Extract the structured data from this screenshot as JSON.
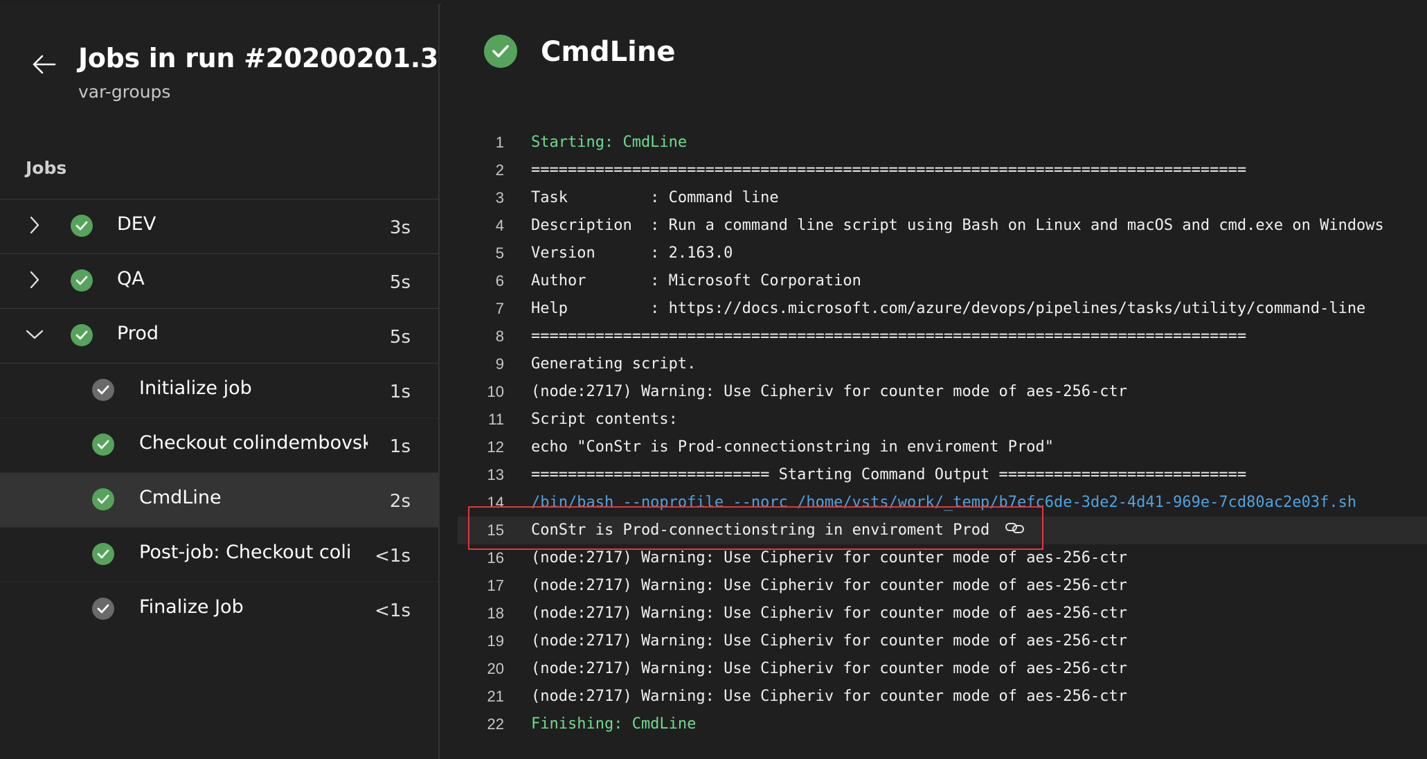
{
  "left_pane": {
    "title": "Jobs in run #20200201.3",
    "subtitle": "var-groups",
    "jobs_heading": "Jobs",
    "jobs": [
      {
        "name": "DEV",
        "duration": "3s",
        "expanded": false,
        "status": "succeeded"
      },
      {
        "name": "QA",
        "duration": "5s",
        "expanded": false,
        "status": "succeeded"
      },
      {
        "name": "Prod",
        "duration": "5s",
        "expanded": true,
        "status": "succeeded"
      }
    ],
    "steps": [
      {
        "name": "Initialize job",
        "duration": "1s",
        "status": "completed"
      },
      {
        "name": "Checkout colindembovsky,",
        "duration": "1s",
        "status": "succeeded"
      },
      {
        "name": "CmdLine",
        "duration": "2s",
        "status": "succeeded",
        "selected": true
      },
      {
        "name": "Post-job: Checkout colinc",
        "duration": "<1s",
        "status": "succeeded"
      },
      {
        "name": "Finalize Job",
        "duration": "<1s",
        "status": "completed"
      }
    ]
  },
  "main": {
    "task_title": "CmdLine",
    "log_lines": [
      {
        "n": "1",
        "text": "Starting: CmdLine",
        "style": "green"
      },
      {
        "n": "2",
        "text": "==============================================================================",
        "style": ""
      },
      {
        "n": "3",
        "text": "Task         : Command line",
        "style": ""
      },
      {
        "n": "4",
        "text": "Description  : Run a command line script using Bash on Linux and macOS and cmd.exe on Windows",
        "style": ""
      },
      {
        "n": "5",
        "text": "Version      : 2.163.0",
        "style": ""
      },
      {
        "n": "6",
        "text": "Author       : Microsoft Corporation",
        "style": ""
      },
      {
        "n": "7",
        "text": "Help         : https://docs.microsoft.com/azure/devops/pipelines/tasks/utility/command-line",
        "style": ""
      },
      {
        "n": "8",
        "text": "==============================================================================",
        "style": ""
      },
      {
        "n": "9",
        "text": "Generating script.",
        "style": ""
      },
      {
        "n": "10",
        "text": "(node:2717) Warning: Use Cipheriv for counter mode of aes-256-ctr",
        "style": ""
      },
      {
        "n": "11",
        "text": "Script contents:",
        "style": ""
      },
      {
        "n": "12",
        "text": "echo \"ConStr is Prod-connectionstring in enviroment Prod\"",
        "style": ""
      },
      {
        "n": "13",
        "text": "========================== Starting Command Output ===========================",
        "style": ""
      },
      {
        "n": "14",
        "text": "/bin/bash --noprofile --norc /home/vsts/work/_temp/b7efc6de-3de2-4d41-969e-7cd80ac2e03f.sh",
        "style": "blue"
      },
      {
        "n": "15",
        "text": "ConStr is Prod-connectionstring in enviroment Prod",
        "style": "",
        "highlighted": true
      },
      {
        "n": "16",
        "text": "(node:2717) Warning: Use Cipheriv for counter mode of aes-256-ctr",
        "style": ""
      },
      {
        "n": "17",
        "text": "(node:2717) Warning: Use Cipheriv for counter mode of aes-256-ctr",
        "style": ""
      },
      {
        "n": "18",
        "text": "(node:2717) Warning: Use Cipheriv for counter mode of aes-256-ctr",
        "style": ""
      },
      {
        "n": "19",
        "text": "(node:2717) Warning: Use Cipheriv for counter mode of aes-256-ctr",
        "style": ""
      },
      {
        "n": "20",
        "text": "(node:2717) Warning: Use Cipheriv for counter mode of aes-256-ctr",
        "style": ""
      },
      {
        "n": "21",
        "text": "(node:2717) Warning: Use Cipheriv for counter mode of aes-256-ctr",
        "style": ""
      },
      {
        "n": "22",
        "text": "Finishing: CmdLine",
        "style": "green"
      }
    ]
  },
  "colors": {
    "success": "#56a35b",
    "neutral": "#6a6a6a",
    "log_green": "#6fdc8c",
    "log_blue": "#4fa3e0",
    "annotation_red": "#e0393e"
  },
  "icons": {
    "back": "arrow-left-icon",
    "collapsed": "chevron-right-icon",
    "expanded": "chevron-down-icon",
    "status": "check-circle-icon",
    "line_link": "link-icon"
  }
}
